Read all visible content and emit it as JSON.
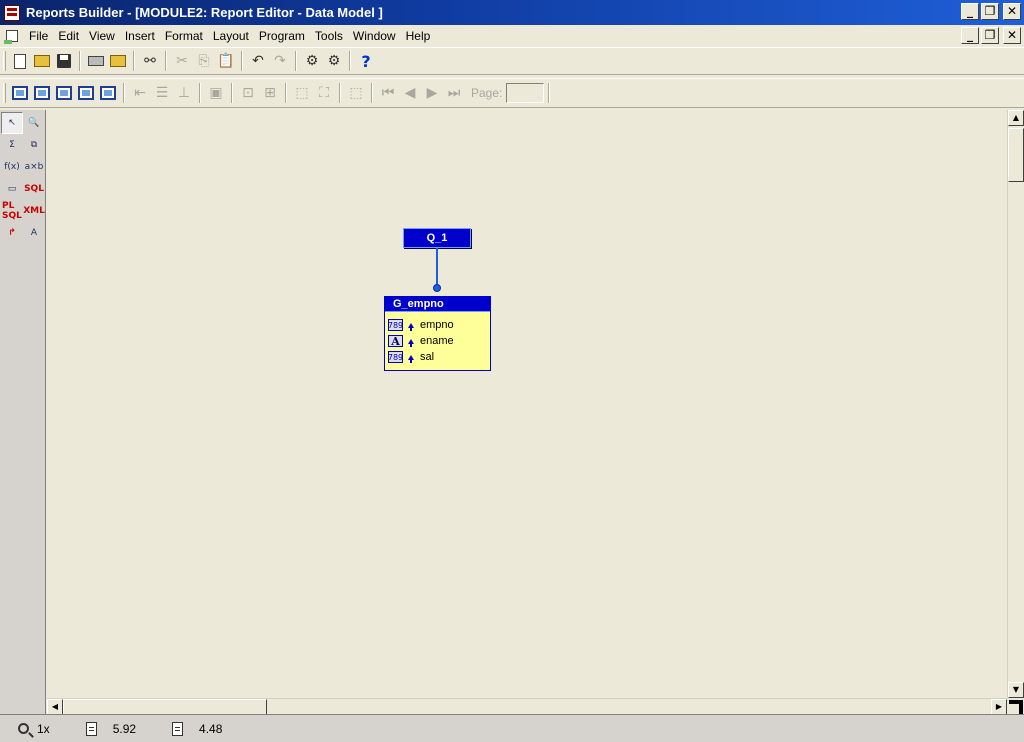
{
  "window": {
    "title": "Reports Builder - [MODULE2: Report Editor - Data Model ]",
    "minimize": "_",
    "restore": "❐",
    "close": "✕"
  },
  "menu": {
    "items": [
      {
        "label": "File"
      },
      {
        "label": "Edit"
      },
      {
        "label": "View"
      },
      {
        "label": "Insert"
      },
      {
        "label": "Format"
      },
      {
        "label": "Layout"
      },
      {
        "label": "Program"
      },
      {
        "label": "Tools"
      },
      {
        "label": "Window"
      },
      {
        "label": "Help"
      }
    ]
  },
  "toolbar": {
    "help_glyph": "?",
    "page_label": "Page:",
    "page_value": ""
  },
  "palette": {
    "items": [
      {
        "name": "select-tool-icon",
        "glyph": "↖"
      },
      {
        "name": "magnify-tool-icon",
        "glyph": "🔍"
      },
      {
        "name": "summary-column-icon",
        "glyph": "Σ"
      },
      {
        "name": "data-link-icon",
        "glyph": "⧉"
      },
      {
        "name": "formula-column-icon",
        "glyph": "f(x)"
      },
      {
        "name": "placeholder-column-icon",
        "glyph": "a×b"
      },
      {
        "name": "cross-product-icon",
        "glyph": "▭"
      },
      {
        "name": "sql-query-icon",
        "glyph": "SQL"
      },
      {
        "name": "plsql-query-icon",
        "glyph": "PL SQL"
      },
      {
        "name": "xml-query-icon",
        "glyph": "XML"
      },
      {
        "name": "ref-cursor-icon",
        "glyph": "↱"
      },
      {
        "name": "text-query-icon",
        "glyph": "A"
      }
    ]
  },
  "data_model": {
    "query_name": "Q_1",
    "group": {
      "name": "G_empno",
      "columns": [
        {
          "type": "number",
          "type_glyph": "789",
          "name": "empno"
        },
        {
          "type": "text",
          "type_glyph": "A",
          "name": "ename"
        },
        {
          "type": "number",
          "type_glyph": "789",
          "name": "sal"
        }
      ]
    }
  },
  "statusbar": {
    "zoom": "1x",
    "x": "5.92",
    "y": "4.48"
  },
  "colors": {
    "query_fill": "#0000cc",
    "group_fill": "#ffff99",
    "canvas": "#ece9d8"
  }
}
